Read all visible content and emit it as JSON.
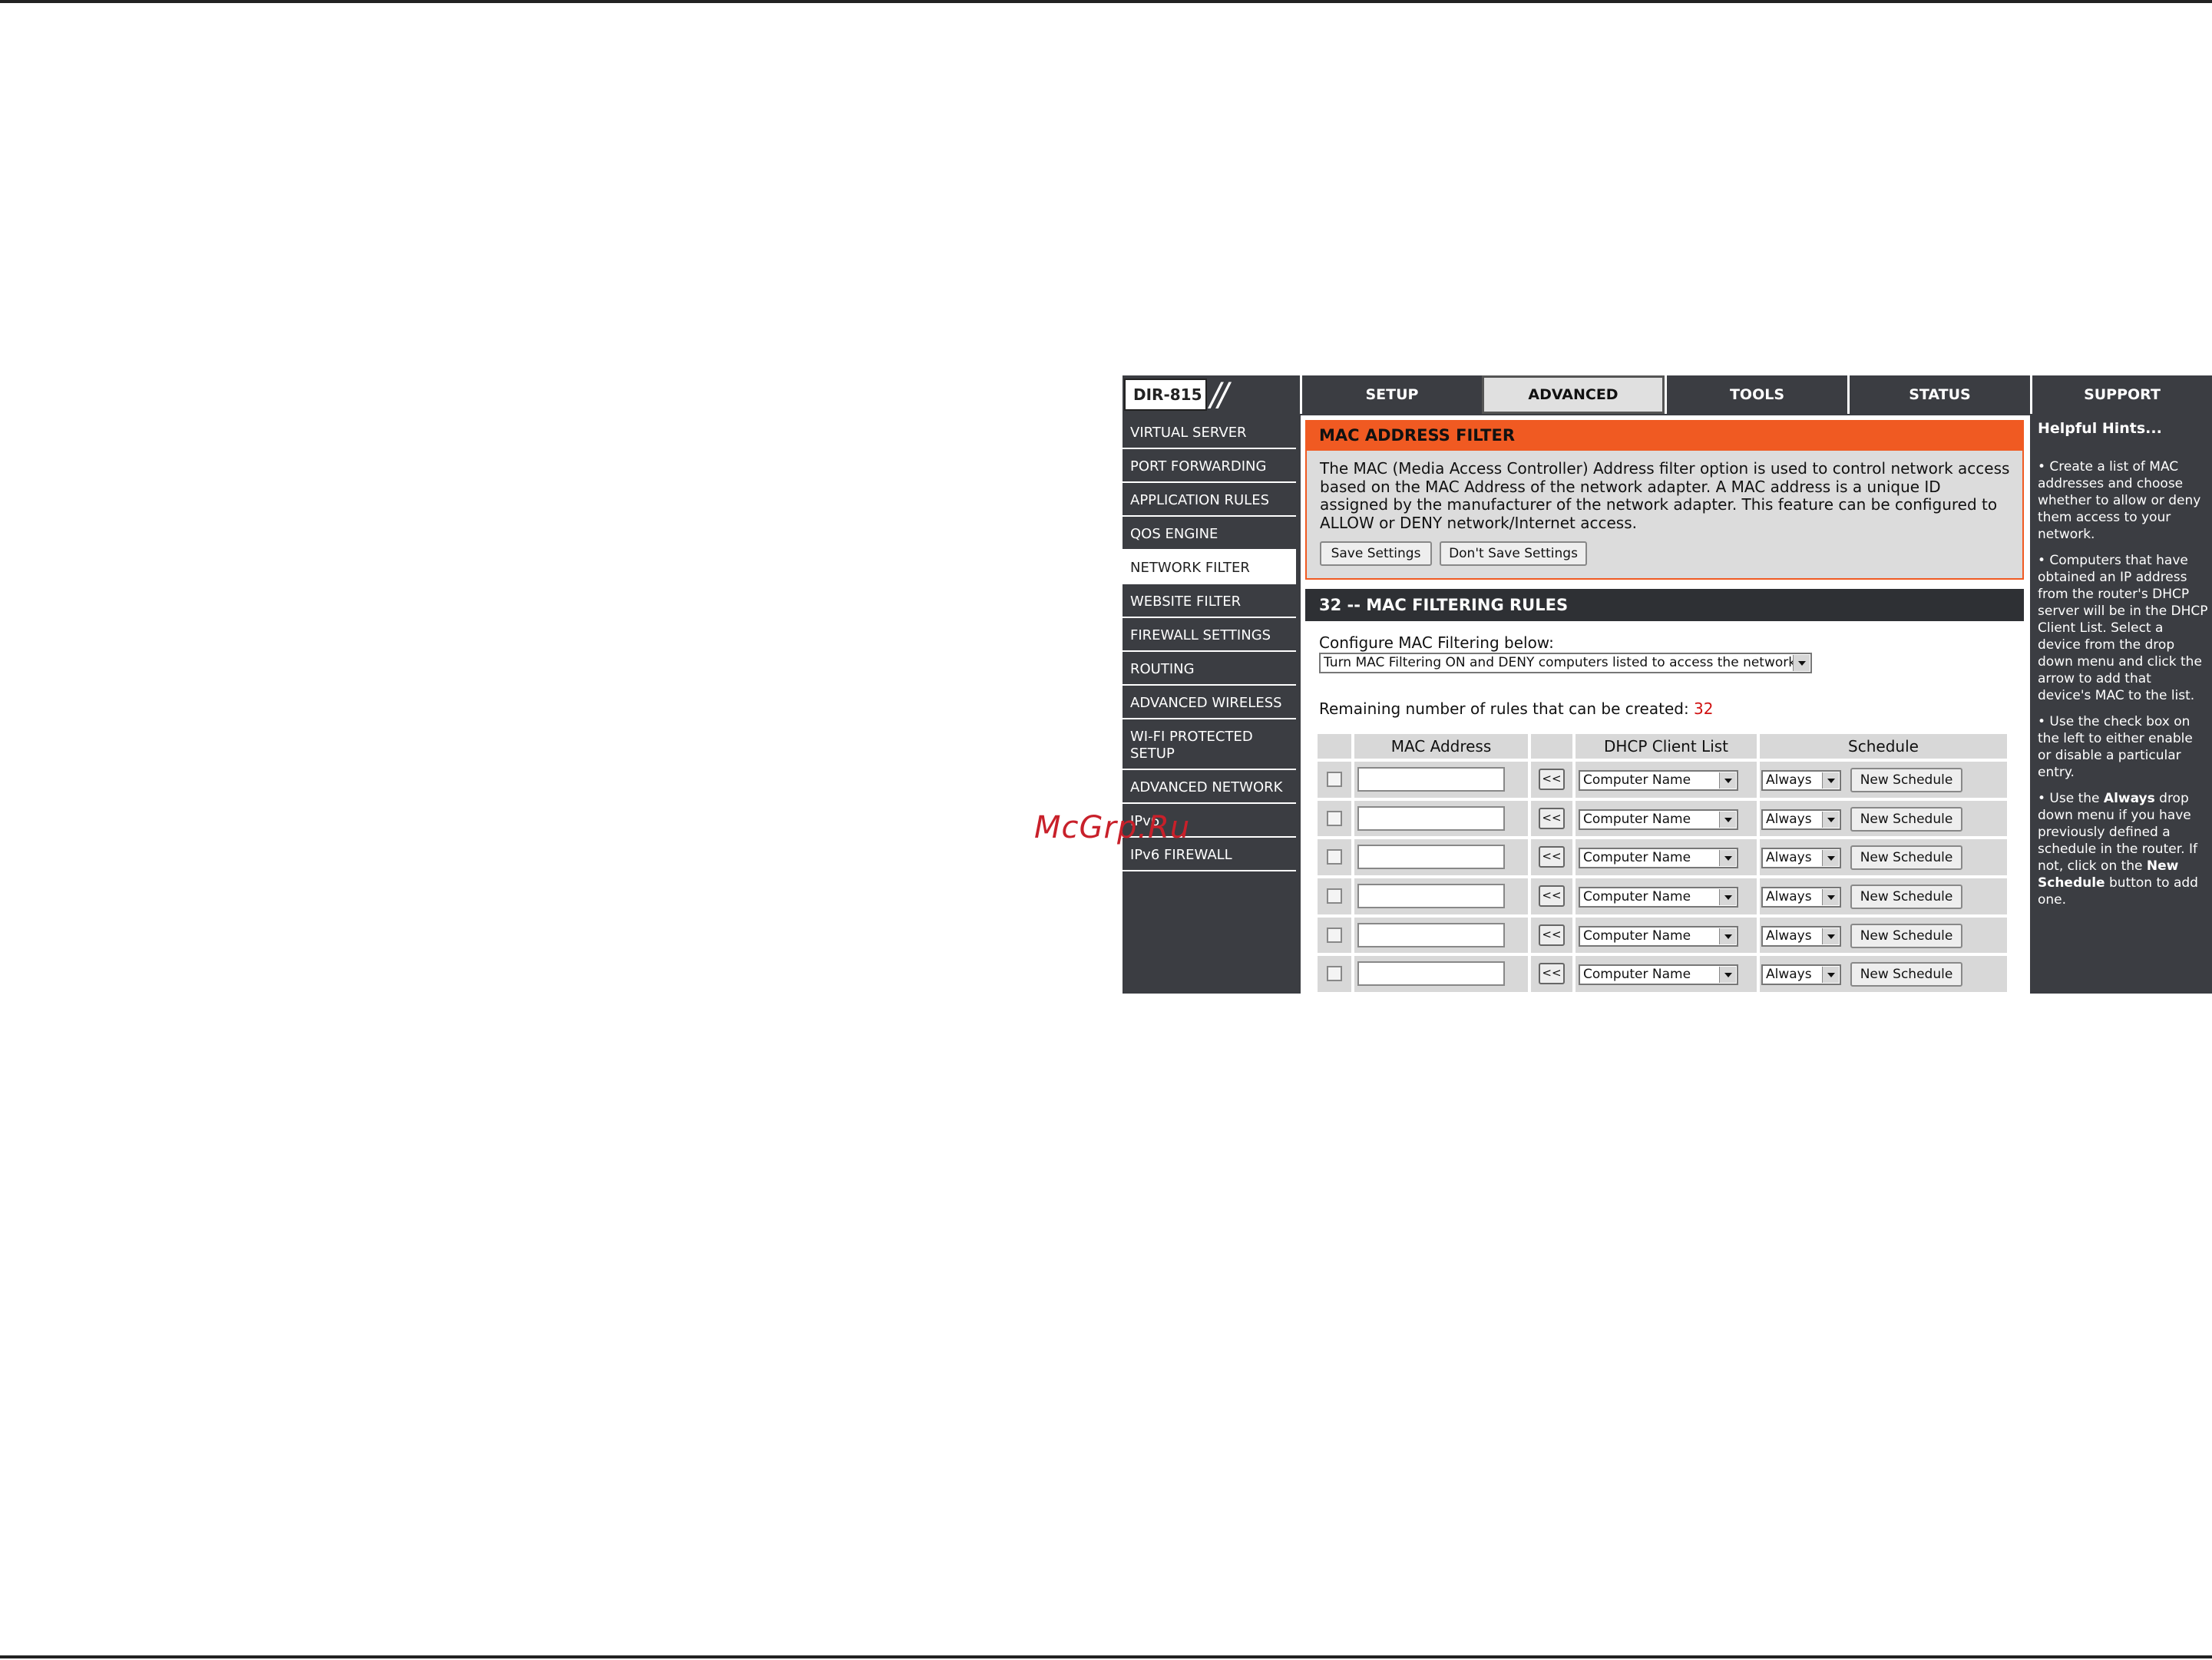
{
  "watermark": "McGrp.Ru",
  "header": {
    "model": "DIR-815",
    "slashes": "//",
    "tabs": [
      {
        "label": "SETUP"
      },
      {
        "label": "ADVANCED"
      },
      {
        "label": "TOOLS"
      },
      {
        "label": "STATUS"
      },
      {
        "label": "SUPPORT"
      }
    ],
    "active_tab": "ADVANCED"
  },
  "sidebar": {
    "items": [
      {
        "label": "VIRTUAL SERVER"
      },
      {
        "label": "PORT FORWARDING"
      },
      {
        "label": "APPLICATION RULES"
      },
      {
        "label": "QOS ENGINE"
      },
      {
        "label": "NETWORK FILTER"
      },
      {
        "label": "WEBSITE FILTER"
      },
      {
        "label": "FIREWALL SETTINGS"
      },
      {
        "label": "ROUTING"
      },
      {
        "label": "ADVANCED WIRELESS"
      },
      {
        "label": "WI-FI PROTECTED\nSETUP"
      },
      {
        "label": "ADVANCED NETWORK"
      },
      {
        "label": "IPv6"
      },
      {
        "label": "IPv6 FIREWALL"
      }
    ],
    "active": "NETWORK FILTER"
  },
  "mac_filter": {
    "title": "MAC ADDRESS FILTER",
    "description": "The MAC (Media Access Controller) Address filter option is used to control network access based on the MAC Address of the network adapter. A MAC address is a unique ID assigned by the manufacturer of the network adapter. This feature can be configured to ALLOW or DENY network/Internet access.",
    "save_label": "Save Settings",
    "dont_save_label": "Don't Save Settings"
  },
  "rules": {
    "title": "32 -- MAC FILTERING RULES",
    "configure_label": "Configure MAC Filtering below:",
    "mode_value": "Turn MAC Filtering ON and DENY computers listed to access the network",
    "remaining_label": "Remaining number of rules that can be created:",
    "remaining_count": "32",
    "columns": {
      "mac": "MAC Address",
      "dhcp": "DHCP Client List",
      "schedule": "Schedule"
    },
    "row_template": {
      "arrow": "<<",
      "computer": "Computer Name",
      "schedule": "Always",
      "new_schedule": "New Schedule"
    },
    "row_count": 6
  },
  "hints": {
    "title": "Helpful Hints...",
    "items": [
      {
        "text": "• Create a list of MAC addresses and choose whether to allow or deny them access to your network."
      },
      {
        "text": "• Computers that have obtained an IP address from the router's DHCP server will be in the DHCP Client List. Select a device from the drop down menu and click the arrow to add that device's MAC to the list."
      },
      {
        "text": "• Use the check box on the left to either enable or disable a particular entry."
      },
      {
        "pre": "• Use the ",
        "bold1": "Always",
        "mid": " drop down menu if you have previously defined a schedule in the router. If not, click on the ",
        "bold2": "New Schedule",
        "post": " button to add one."
      }
    ]
  },
  "colors": {
    "frame": "#3b3d42",
    "accent_orange": "#f05a22",
    "section_dark": "#2e3034",
    "remaining_red": "#d01010"
  }
}
